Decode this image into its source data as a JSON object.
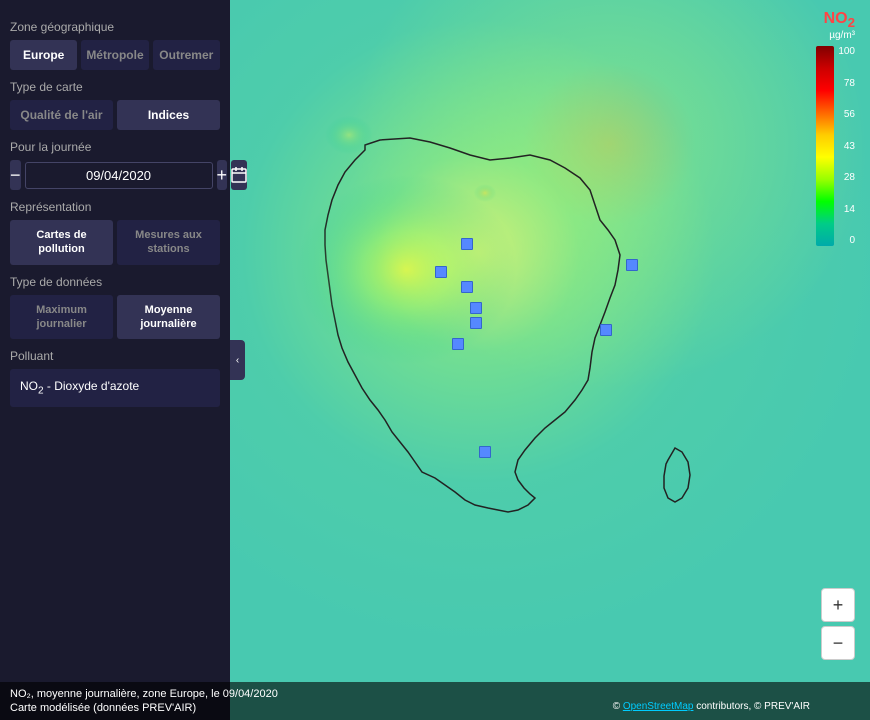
{
  "sidebar": {
    "zone_label": "Zone géographique",
    "zone_buttons": [
      {
        "label": "Europe",
        "active": true
      },
      {
        "label": "Métropole",
        "active": false
      },
      {
        "label": "Outremer",
        "active": false
      }
    ],
    "type_carte_label": "Type de carte",
    "type_carte_buttons": [
      {
        "label": "Qualité de l'air",
        "active": false
      },
      {
        "label": "Indices",
        "active": true
      }
    ],
    "journee_label": "Pour la journée",
    "date_minus": "−",
    "date_value": "09/04/2020",
    "date_plus": "+",
    "representation_label": "Représentation",
    "representation_buttons": [
      {
        "label": "Cartes de pollution",
        "active": true
      },
      {
        "label": "Mesures aux stations",
        "active": false
      }
    ],
    "donnees_label": "Type de données",
    "donnees_buttons": [
      {
        "label": "Maximum journalier",
        "active": false
      },
      {
        "label": "Moyenne journalière",
        "active": true
      }
    ],
    "polluant_label": "Polluant",
    "polluant_value": "NO₂ - Dioxyde d'azote",
    "collapse_icon": "‹"
  },
  "legend": {
    "title": "NO₂",
    "unit": "µg/m³",
    "values": [
      "100",
      "78",
      "56",
      "43",
      "28",
      "14",
      "0"
    ]
  },
  "status": {
    "line1": "NO₂, moyenne journalière, zone Europe, le 09/04/2020",
    "line2": "Carte modélisée (données PREV'AIR)",
    "attribution": "© OpenStreetMap contributors, © PREV'AIR"
  },
  "zoom": {
    "in_label": "+",
    "out_label": "−"
  },
  "stations": [
    {
      "top": "33%",
      "left": "53%"
    },
    {
      "top": "37%",
      "left": "50%"
    },
    {
      "top": "39%",
      "left": "53%"
    },
    {
      "top": "42%",
      "left": "54%"
    },
    {
      "top": "44%",
      "left": "54%"
    },
    {
      "top": "47%",
      "left": "52%"
    },
    {
      "top": "62%",
      "left": "55%"
    },
    {
      "top": "45%",
      "left": "69%"
    },
    {
      "top": "36%",
      "left": "72%"
    }
  ]
}
